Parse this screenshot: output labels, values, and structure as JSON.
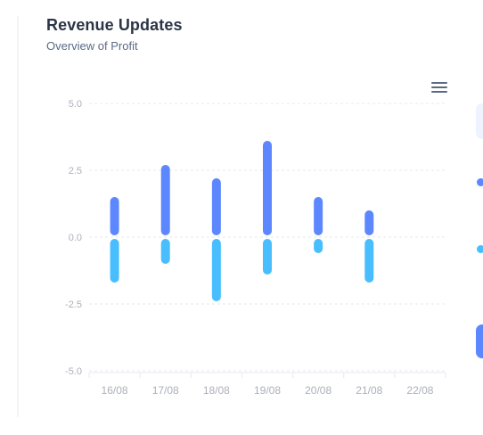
{
  "card": {
    "title": "Revenue Updates",
    "subtitle": "Overview of Profit",
    "menu_icon": "hamburger-menu-icon"
  },
  "colors": {
    "series_a": "#5d87ff",
    "series_b": "#49beff",
    "grid": "#e5eaef",
    "tick_text": "#adb0bb"
  },
  "chart_data": {
    "type": "bar",
    "categories": [
      "16/08",
      "17/08",
      "18/08",
      "19/08",
      "20/08",
      "21/08",
      "22/08"
    ],
    "series": [
      {
        "values": [
          1.5,
          2.7,
          2.2,
          3.6,
          1.5,
          1.0,
          null
        ]
      },
      {
        "values": [
          -1.7,
          -1.0,
          -2.4,
          -1.4,
          -0.6,
          -1.7,
          null
        ]
      }
    ],
    "yticks": [
      "5.0",
      "2.5",
      "0.0",
      "-2.5",
      "-5.0"
    ],
    "ylim": [
      -5,
      5
    ],
    "grid": true,
    "stacked": true
  }
}
